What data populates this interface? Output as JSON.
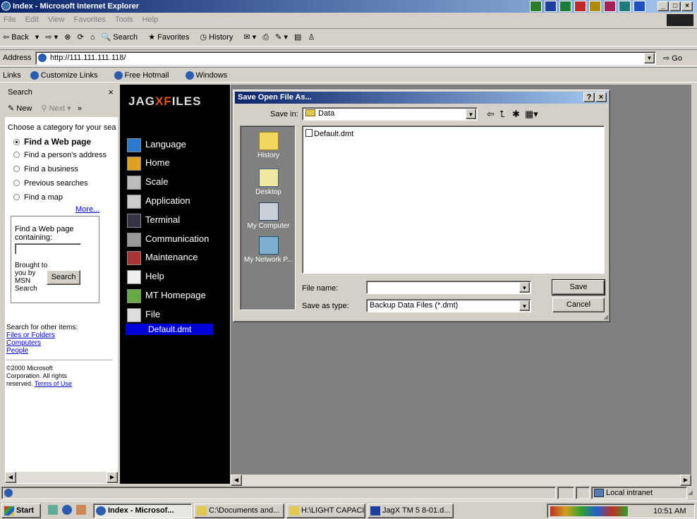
{
  "window": {
    "title": "Index - Microsoft Internet Explorer"
  },
  "menu": [
    "File",
    "Edit",
    "View",
    "Favorites",
    "Tools",
    "Help"
  ],
  "toolbar": {
    "back": "Back",
    "search": "Search",
    "favorites": "Favorites",
    "history": "History"
  },
  "address": {
    "label": "Address",
    "url": "http://111.111.111.118/",
    "go": "Go"
  },
  "links": {
    "label": "Links",
    "items": [
      "Customize Links",
      "Free Hotmail",
      "Windows"
    ]
  },
  "search_pane": {
    "title": "Search",
    "new": "New",
    "next": "Next",
    "prompt": "Choose a category for your sea",
    "options": [
      "Find a Web page",
      "Find a person's address",
      "Find a business",
      "Previous searches",
      "Find a map"
    ],
    "more": "More...",
    "find_label_1": "Find a Web page",
    "find_label_2": "containing:",
    "brought_by": [
      "Brought to",
      "you by",
      "MSN",
      "Search"
    ],
    "search_btn": "Search",
    "other_title": "Search for other items:",
    "other_links": [
      "Files or Folders",
      "Computers",
      "People"
    ],
    "copyright": [
      "©2000 Microsoft",
      "Corporation. All rights",
      "reserved."
    ],
    "terms": "Terms of Use"
  },
  "jag": {
    "logo_a": "JAG",
    "logo_b": "XF",
    "logo_c": "ILES",
    "menu": [
      "Language",
      "Home",
      "Scale",
      "Application",
      "Terminal",
      "Communication",
      "Maintenance",
      "Help",
      "MT Homepage",
      "File"
    ],
    "selected_file": "Default.dmt"
  },
  "dialog": {
    "title": "Save Open File As...",
    "save_in_label": "Save in:",
    "save_in_value": "Data",
    "places": [
      "History",
      "Desktop",
      "My Computer",
      "My Network P..."
    ],
    "files": [
      "Default.dmt"
    ],
    "file_name_label": "File name:",
    "file_name_value": "",
    "type_label": "Save as type:",
    "type_value": "Backup Data Files (*.dmt)",
    "save_btn": "Save",
    "cancel_btn": "Cancel"
  },
  "status": {
    "zone": "Local intranet"
  },
  "taskbar": {
    "start": "Start",
    "tasks": [
      "Index - Microsof...",
      "C:\\Documents and...",
      "H:\\LIGHT CAPACI...",
      "JagX TM 5 8-01.d..."
    ],
    "time": "10:51 AM"
  }
}
